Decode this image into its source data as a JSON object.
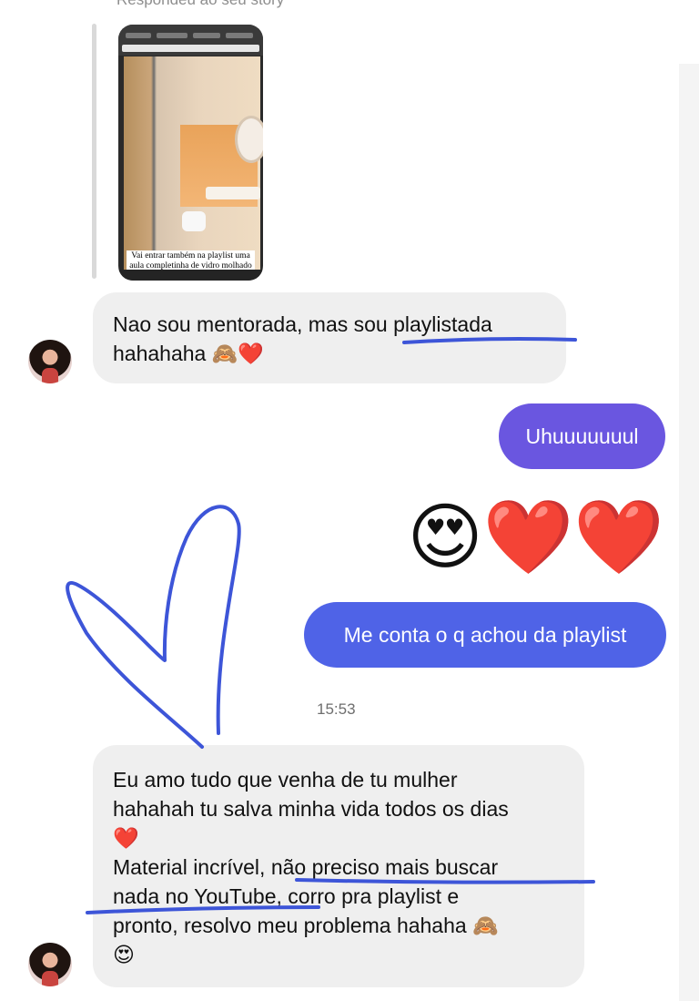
{
  "story_reply": {
    "caption_top": "Respondeu ao seu story",
    "thumbnail_text": "Vai entrar também na playlist uma aula completinha de vidro molhado"
  },
  "messages": [
    {
      "side": "incoming",
      "text": "Nao sou mentorada, mas sou playlistada hahahaha 🙈❤️"
    },
    {
      "side": "outgoing",
      "text": "Uhuuuuuuul",
      "color": "#6a56e0"
    },
    {
      "side": "outgoing",
      "emoji": "😍❤️❤️"
    },
    {
      "side": "outgoing",
      "text": "Me conta o q achou da playlist",
      "color": "#4f63e7"
    },
    {
      "timestamp": "15:53"
    },
    {
      "side": "incoming",
      "lines": [
        "Eu amo tudo que venha de tu mulher",
        "hahahah tu salva minha vida todos os dias",
        "❤️",
        "Material incrível, não preciso mais buscar",
        "nada no YouTube, corro pra playlist e",
        "pronto, resolvo meu problema hahaha 🙈",
        "😍"
      ]
    }
  ],
  "colors": {
    "incoming_bubble": "#efefef",
    "annotation_ink": "#3d55d8"
  },
  "icons": {
    "avatar": "user-avatar-photo"
  }
}
